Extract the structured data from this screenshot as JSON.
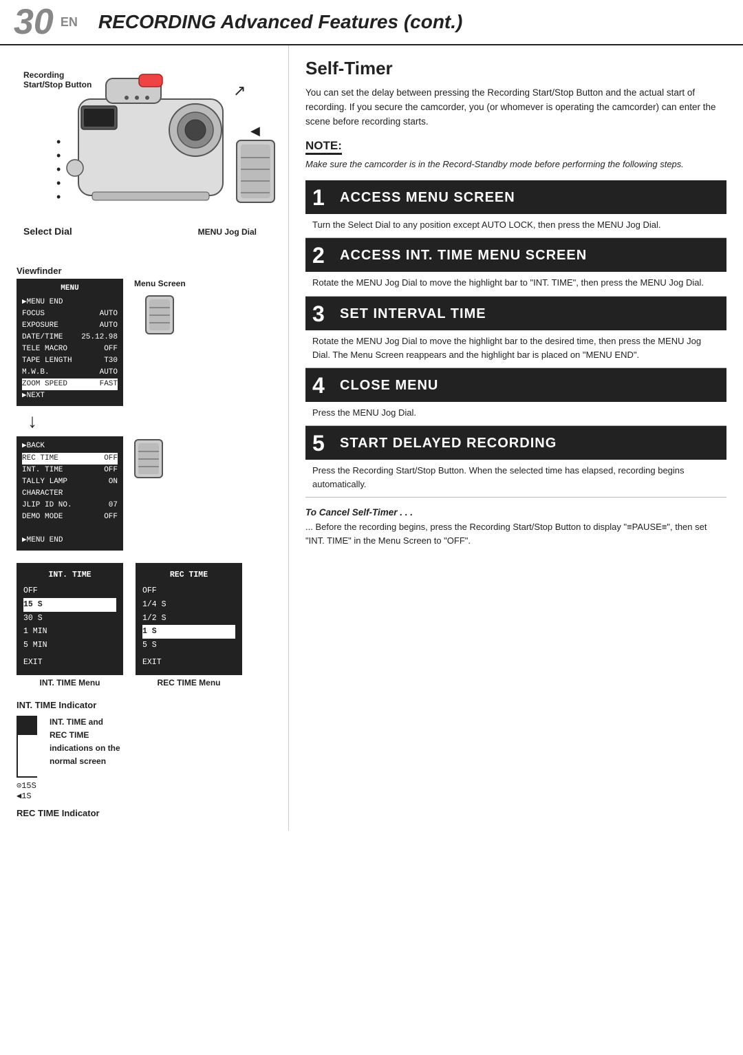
{
  "header": {
    "page_number": "30",
    "page_suffix": "EN",
    "title_italic": "RECORDING",
    "title_rest": " Advanced Features (cont.)"
  },
  "left": {
    "camera_labels": {
      "recording": "Recording",
      "start_stop": "Start/Stop Button",
      "select_dial": "Select Dial",
      "menu_jog_dial": "MENU Jog Dial"
    },
    "viewfinder_label": "Viewfinder",
    "menu_screen_label": "Menu Screen",
    "menu1": {
      "header": "MENU",
      "rows": [
        {
          "left": "▶MENU END",
          "right": "",
          "highlight": false
        },
        {
          "left": "FOCUS",
          "right": "AUTO",
          "highlight": false
        },
        {
          "left": "EXPOSURE",
          "right": "AUTO",
          "highlight": false
        },
        {
          "left": "DATE/TIME",
          "right": "25. 12. 98",
          "highlight": false
        },
        {
          "left": "TELE MACRO",
          "right": "OFF",
          "highlight": false
        },
        {
          "left": "TAPE LENGTH",
          "right": "T30",
          "highlight": false
        },
        {
          "left": "M.W.B.",
          "right": "AUTO",
          "highlight": false
        },
        {
          "left": "ZOOM SPEED",
          "right": "FAST",
          "highlight": true
        },
        {
          "left": "▶NEXT",
          "right": "",
          "highlight": false
        }
      ]
    },
    "menu2": {
      "rows": [
        {
          "left": "▶BACK",
          "right": "",
          "highlight": false
        },
        {
          "left": "REC TIME",
          "right": "OFF",
          "highlight": true
        },
        {
          "left": "INT. TIME",
          "right": "OFF",
          "highlight": false
        },
        {
          "left": "TALLY LAMP",
          "right": "ON",
          "highlight": false
        },
        {
          "left": "CHARACTER",
          "right": "",
          "highlight": false
        },
        {
          "left": "JLIP ID NO.",
          "right": "07",
          "highlight": false
        },
        {
          "left": "DEMO MODE",
          "right": "OFF",
          "highlight": false
        },
        {
          "left": "",
          "right": "",
          "highlight": false
        },
        {
          "left": "▶MENU END",
          "right": "",
          "highlight": false
        }
      ]
    },
    "int_time_menu": {
      "header": "INT. TIME",
      "items": [
        "OFF",
        "15 S",
        "30 S",
        "1  MIN",
        "5  MIN"
      ],
      "highlighted": "15 S",
      "exit": "EXIT",
      "caption": "INT. TIME Menu"
    },
    "rec_time_menu": {
      "header": "REC TIME",
      "items": [
        "OFF",
        "1/4 S",
        "1/2 S",
        "1 S",
        "5 S"
      ],
      "highlighted": "1 S",
      "exit": "EXIT",
      "caption": "REC TIME Menu"
    },
    "int_time_indicator": {
      "title": "INT. TIME Indicator",
      "values": [
        "⊙15S",
        "◀1S"
      ]
    },
    "int_time_rec_label": {
      "line1": "INT. TIME and",
      "line2": "REC TIME",
      "line3": "indications on the",
      "line4": "normal screen"
    },
    "rec_time_indicator_label": "REC TIME Indicator"
  },
  "right": {
    "section_title": "Self-Timer",
    "description": "You can set the delay between pressing the Recording Start/Stop Button and the actual start of recording. If you secure the camcorder, you (or whomever is operating the camcorder) can enter the scene before recording starts.",
    "note_label": "NOTE:",
    "note_text": "Make sure the camcorder is in the Record-Standby mode before performing the following steps.",
    "steps": [
      {
        "number": "1",
        "title": "ACCESS MENU SCREEN",
        "body": "Turn the Select Dial to any position except AUTO LOCK, then press the MENU Jog Dial."
      },
      {
        "number": "2",
        "title": "ACCESS INT. TIME MENU SCREEN",
        "body": "Rotate the MENU Jog Dial to move the highlight bar to \"INT. TIME\", then press the MENU Jog Dial."
      },
      {
        "number": "3",
        "title": "SET INTERVAL TIME",
        "body": "Rotate the MENU Jog Dial to move the highlight bar to the desired time, then press the MENU Jog Dial. The Menu Screen reappears and the highlight bar is placed on \"MENU END\"."
      },
      {
        "number": "4",
        "title": "CLOSE MENU",
        "body": "Press the MENU Jog Dial."
      },
      {
        "number": "5",
        "title": "START DELAYED RECORDING",
        "body": "Press the Recording Start/Stop Button. When the selected time has elapsed, recording begins automatically."
      }
    ],
    "cancel_title": "To Cancel Self-Timer . . .",
    "cancel_text": "... Before the recording begins, press the Recording Start/Stop Button to display \"≡PAUSE≡\", then set \"INT. TIME\" in the Menu Screen to \"OFF\"."
  }
}
